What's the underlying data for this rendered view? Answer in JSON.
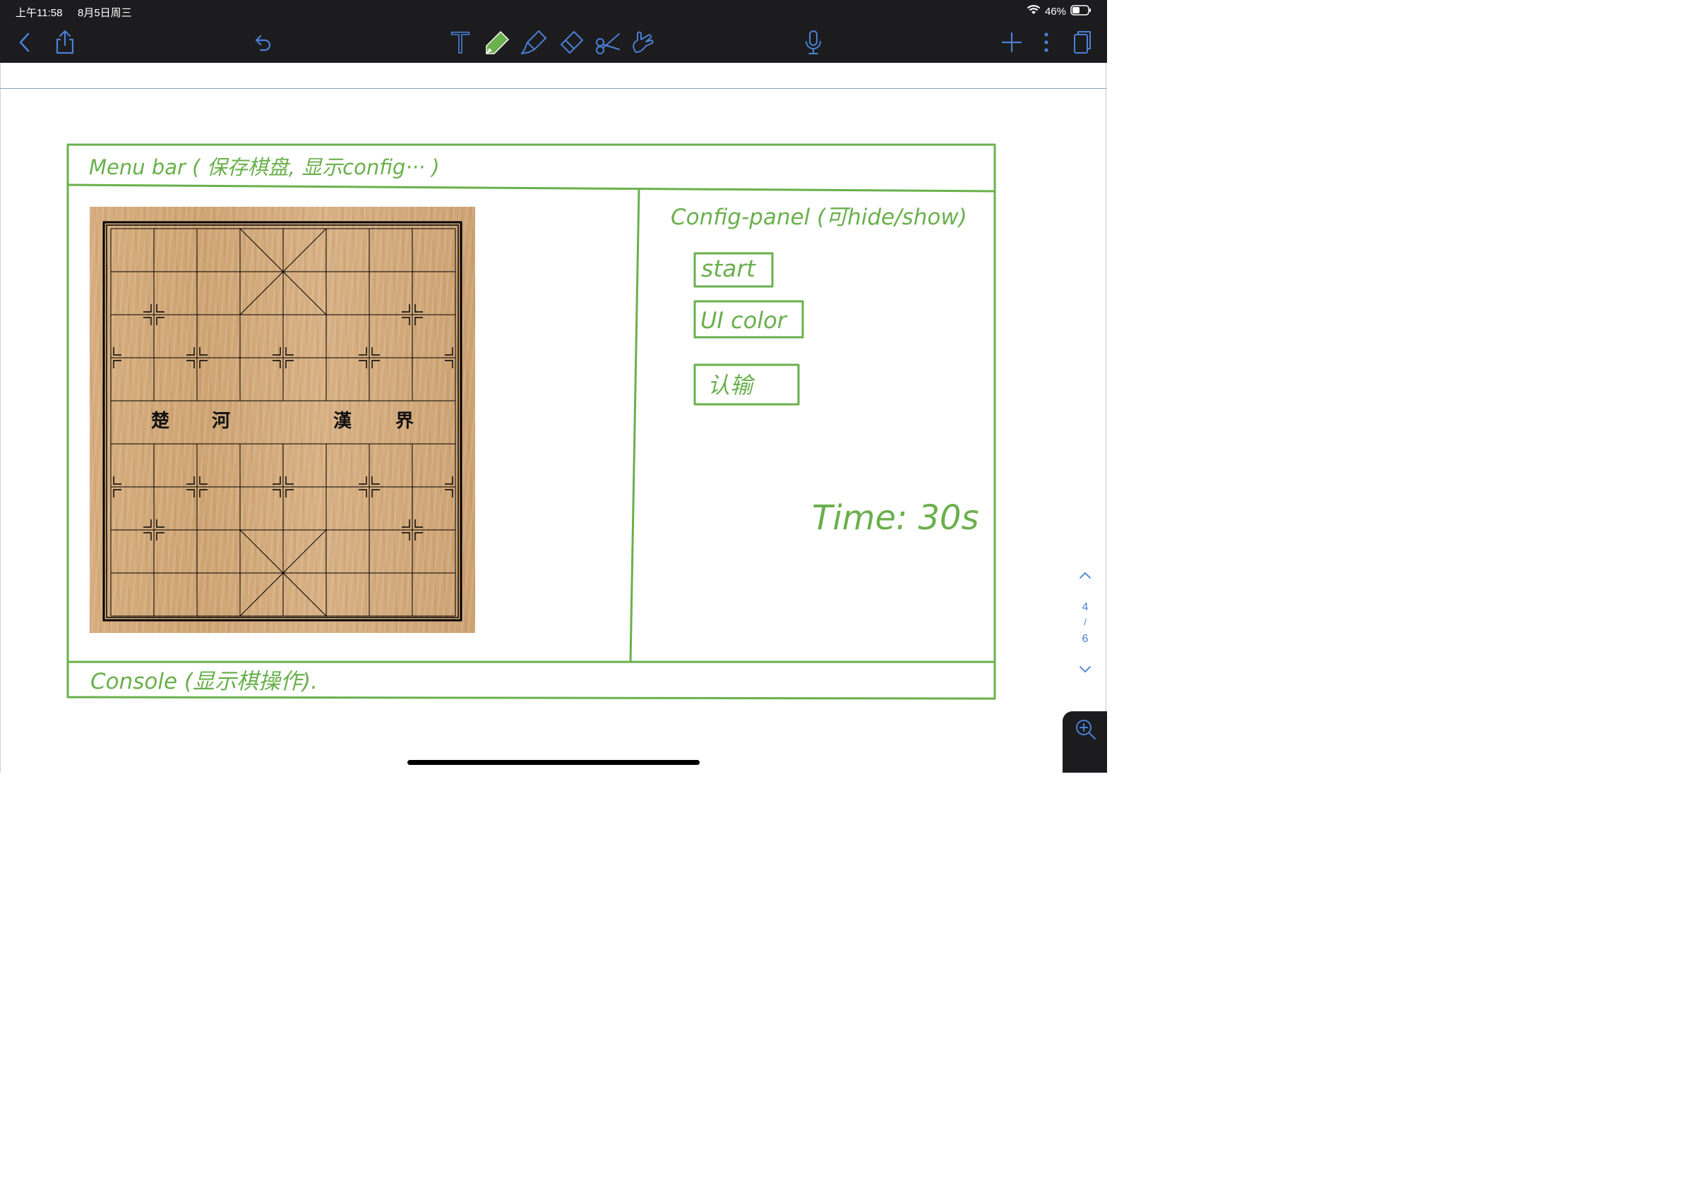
{
  "status_bar": {
    "time": "上午11:58",
    "date": "8月5日周三",
    "battery": "46%"
  },
  "toolbar": {
    "icons": [
      "back-icon",
      "share-icon",
      "undo-icon",
      "text-tool-icon",
      "pen-tool-icon",
      "highlighter-icon",
      "eraser-icon",
      "scissors-icon",
      "hand-tool-icon",
      "microphone-icon",
      "add-icon",
      "more-icon",
      "pages-icon"
    ],
    "text_tool_glyph": "T"
  },
  "sketch": {
    "menu_bar_label": "Menu bar  ( 保存棋盘, 显示config··· )",
    "config_panel_label": "Config-panel (可hide/show)",
    "start_label": "start",
    "ui_color_label": "UI color",
    "resign_label": "认输",
    "time_label": "Time: 30s",
    "console_label": "Console (显示棋操作)."
  },
  "board": {
    "river_chars": [
      "楚",
      "河",
      "漢",
      "界"
    ]
  },
  "page_nav": {
    "current": "4",
    "separator": "/",
    "total": "6"
  },
  "colors": {
    "ink": "#6ab04c",
    "toolbar_bg": "#1c1c1e",
    "nav_blue": "#4a7fd6"
  }
}
